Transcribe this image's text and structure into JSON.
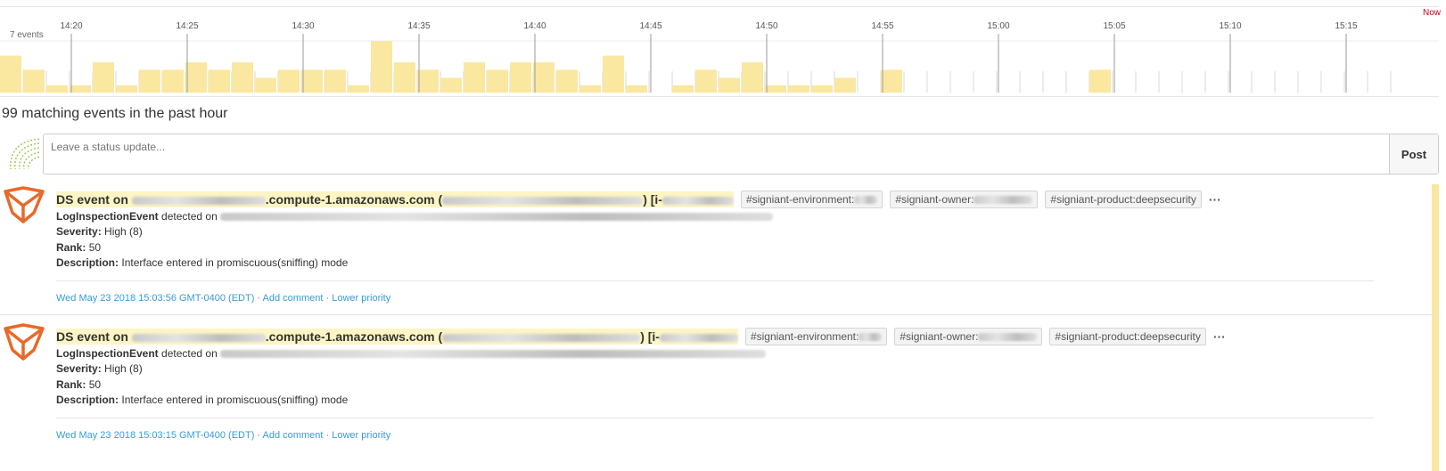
{
  "timeline": {
    "now_label": "Now",
    "events_label": "7 events",
    "ticks": [
      "14:20",
      "14:25",
      "14:30",
      "14:35",
      "14:40",
      "14:45",
      "14:50",
      "14:55",
      "15:00",
      "15:05",
      "15:10",
      "15:15"
    ],
    "bar_values": [
      5,
      3.1,
      1,
      1,
      4.1,
      1,
      3.1,
      3.1,
      4.1,
      3.1,
      4.1,
      2,
      3.1,
      3.1,
      3.1,
      1,
      7,
      4.1,
      3.1,
      2,
      4.1,
      3.1,
      4.1,
      4.1,
      3.1,
      1,
      5,
      1,
      0,
      1,
      3.1,
      2,
      4.1,
      1,
      1,
      1,
      2,
      0,
      3.1,
      0,
      0,
      0,
      0,
      0,
      0,
      0,
      0,
      3.1,
      0,
      0,
      0,
      0,
      0,
      0,
      0,
      0,
      0,
      0,
      0,
      0
    ],
    "bar_color": "#fae8a0",
    "max_value": 7
  },
  "summary": "99 matching events in the past hour",
  "status": {
    "placeholder": "Leave a status update...",
    "post_label": "Post"
  },
  "events": [
    {
      "title_prefix": "DS event on",
      "title_host": ".compute-1.amazonaws.com (",
      "title_mid": ") [i-",
      "tags": [
        "#signiant-environment:",
        "#signiant-owner:",
        "#signiant-product:deepsecurity"
      ],
      "detected_key": "LogInspectionEvent",
      "detected_text": "detected on",
      "severity_label": "Severity:",
      "severity_value": "High (8)",
      "rank_label": "Rank:",
      "rank_value": "50",
      "description_label": "Description:",
      "description_value": "Interface entered in promiscuous(sniffing) mode",
      "timestamp": "Wed May 23 2018 15:03:56 GMT-0400 (EDT)",
      "add_comment": "Add comment",
      "lower_priority": "Lower priority",
      "separator": "·"
    },
    {
      "title_prefix": "DS event on",
      "title_host": ".compute-1.amazonaws.com (",
      "title_mid": ") [i-",
      "tags": [
        "#signiant-environment:",
        "#signiant-owner:",
        "#signiant-product:deepsecurity"
      ],
      "detected_key": "LogInspectionEvent",
      "detected_text": "detected on",
      "severity_label": "Severity:",
      "severity_value": "High (8)",
      "rank_label": "Rank:",
      "rank_value": "50",
      "description_label": "Description:",
      "description_value": "Interface entered in promiscuous(sniffing) mode",
      "timestamp": "Wed May 23 2018 15:03:15 GMT-0400 (EDT)",
      "add_comment": "Add comment",
      "lower_priority": "Lower priority",
      "separator": "·"
    }
  ],
  "colors": {
    "accent_link": "#3a9bd5",
    "title_highlight": "#fdf5c4",
    "logo_orange": "#e8692a",
    "now_red": "#d0021b"
  },
  "icons": {
    "status_avatar": "datadog-swirl-icon",
    "event_logo": "trend-micro-deep-security-icon"
  }
}
